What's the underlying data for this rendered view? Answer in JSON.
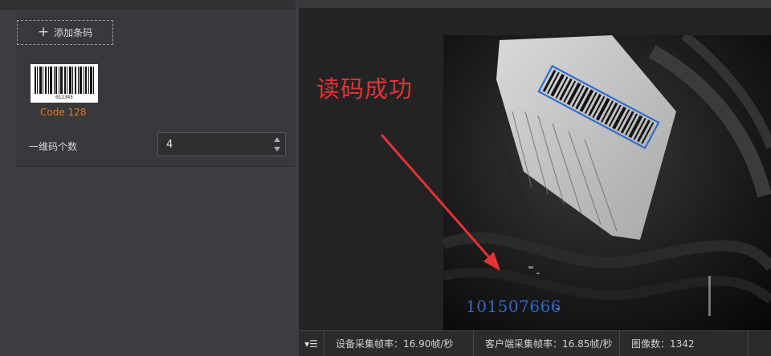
{
  "left_panel": {
    "add_barcode_label": "添加条码",
    "barcode_card": {
      "barcode_number": "012345",
      "barcode_type": "Code 128",
      "count_label": "一维码个数",
      "count_value": "4"
    }
  },
  "viewer": {
    "overlay_success_text": "读码成功",
    "decoded_text": "101507666"
  },
  "status_bar": {
    "device_fps": "设备采集帧率：16.90帧/秒",
    "client_fps": "客户端采集帧率：16.85帧/秒",
    "image_count": "图像数：1342"
  },
  "colors": {
    "accent_orange": "#e8731a",
    "success_red": "#e53232",
    "decode_blue": "#2f69c9"
  }
}
